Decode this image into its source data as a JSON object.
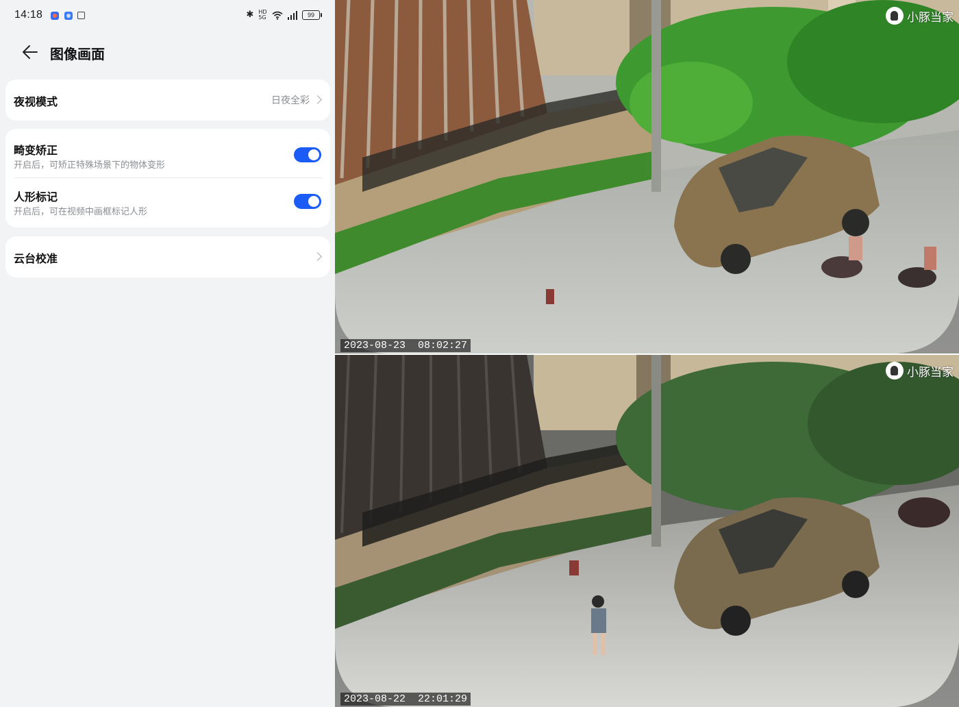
{
  "status_bar": {
    "time": "14:18",
    "network": "5G",
    "network_sub": "HD",
    "battery": "99"
  },
  "header": {
    "title": "图像画面"
  },
  "settings": {
    "night_mode": {
      "label": "夜视模式",
      "value": "日夜全彩"
    },
    "distortion": {
      "label": "畸变矫正",
      "desc": "开启后，可矫正特殊场景下的物体变形",
      "enabled": true
    },
    "human_mark": {
      "label": "人形标记",
      "desc": "开启后，可在视频中画框标记人形",
      "enabled": true
    },
    "ptz": {
      "label": "云台校准"
    }
  },
  "camera": {
    "brand": "小豚当家",
    "day_timestamp": "2023-08-23  08:02:27",
    "night_timestamp": "2023-08-22  22:01:29"
  },
  "colors": {
    "accent": "#1a5cf5",
    "background": "#f1f3f5",
    "card": "#ffffff",
    "secondary_text": "#8a8d92"
  }
}
